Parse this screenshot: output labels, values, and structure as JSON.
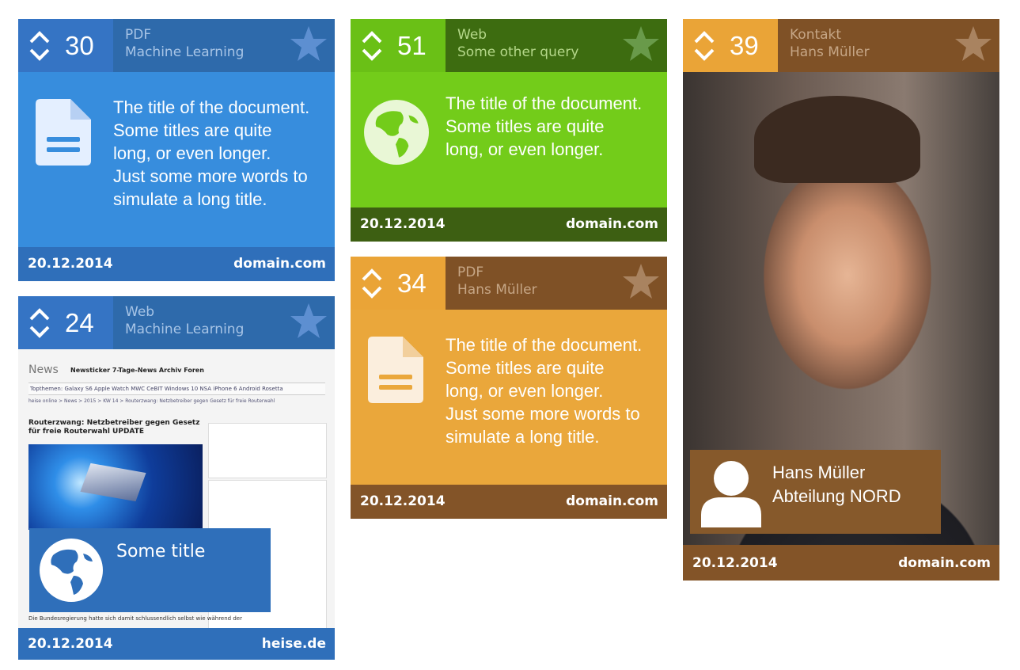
{
  "cards": [
    {
      "score": "30",
      "type": "PDF",
      "query": "Machine Learning",
      "title_lines": [
        "The title of the document.",
        "Some titles are quite",
        "long, or even longer.",
        "Just some more words to",
        "simulate a long title."
      ],
      "date": "20.12.2014",
      "domain": "domain.com",
      "colors": {
        "score": "#3574c4",
        "meta": "#2e6aab",
        "body": "#378ddd",
        "footer": "#2f6fba"
      }
    },
    {
      "score": "24",
      "type": "Web",
      "query": "Machine Learning",
      "overlay_title": "Some title",
      "date": "20.12.2014",
      "domain": "heise.de",
      "screenshot": {
        "brand": "News",
        "nav": "Newsticker   7-Tage-News   Archiv   Foren",
        "topics": "Topthemen:      Galaxy S6    Apple Watch    MWC    CeBIT    Windows 10    NSA    iPhone 6    Android    Rosetta",
        "crumb": "heise online  >  News  >  2015  >  KW 14  >  Routerzwang: Netzbetreiber gegen Gesetz für freie Routerwahl",
        "headline": "Routerzwang: Netzbetreiber gegen Gesetz für freie Routerwahl UPDATE",
        "bottom": "Die Bundesregierung hatte sich damit schlussendlich selbst wie während der"
      },
      "colors": {
        "score": "#3574c4",
        "meta": "#2e6aab",
        "footer": "#2f6fba"
      }
    },
    {
      "score": "51",
      "type": "Web",
      "query": "Some other query",
      "title_lines": [
        "The title of the document.",
        "Some titles are quite",
        "long, or even longer."
      ],
      "date": "20.12.2014",
      "domain": "domain.com",
      "colors": {
        "score": "#6ac016",
        "meta": "#3d6c10",
        "body": "#73cc1a",
        "footer": "#3d5f12"
      }
    },
    {
      "score": "34",
      "type": "PDF",
      "query": "Hans Müller",
      "title_lines": [
        "The title of the document.",
        "Some titles are quite",
        "long, or even longer.",
        "Just some more words to",
        "simulate a long title."
      ],
      "date": "20.12.2014",
      "domain": "domain.com",
      "colors": {
        "score": "#eaa437",
        "meta": "#7f5126",
        "body": "#eaa73b",
        "footer": "#835428"
      }
    },
    {
      "score": "39",
      "type": "Kontakt",
      "query": "Hans Müller",
      "person_name": "Hans Müller",
      "person_dept": "Abteilung NORD",
      "date": "20.12.2014",
      "domain": "domain.com",
      "colors": {
        "score": "#eaa437",
        "meta": "#7f5126",
        "footer": "#835428",
        "box": "#86592b"
      }
    }
  ]
}
